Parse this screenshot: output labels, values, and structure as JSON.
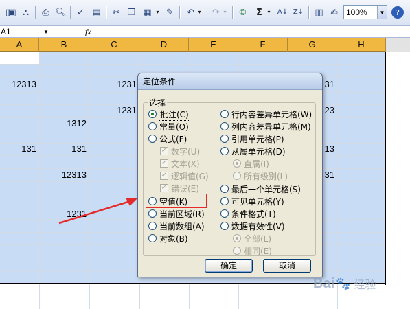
{
  "toolbar": {
    "icons": [
      "new-file-icon",
      "open-folder-icon",
      "save-icon",
      "permission-icon",
      "print-icon",
      "print-preview-icon",
      "spelling-icon",
      "research-icon",
      "cut-icon",
      "copy-icon",
      "paste-icon",
      "format-painter-icon",
      "undo-icon",
      "redo-icon",
      "hyperlink-icon",
      "autosum-icon",
      "sort-ascending-icon",
      "sort-descending-icon",
      "chart-wizard-icon",
      "drawing-icon"
    ],
    "autosum_glyph": "Σ",
    "zoom_value": "100%",
    "help_glyph": "?"
  },
  "formula_bar": {
    "name_box": "A1",
    "fx_label": "fx"
  },
  "columns": [
    "A",
    "B",
    "C",
    "D",
    "E",
    "F",
    "G",
    "H"
  ],
  "cells": {
    "a_r3": "12313",
    "c_r3": "1231",
    "c_r5": "1231",
    "b_r6": "1312",
    "a_r8": "131",
    "b_r8": "131",
    "b_r10": "12313",
    "b_r13": "1231",
    "g_r3": "31",
    "g_r5": "23",
    "g_r8": "13",
    "g_r10": "31"
  },
  "dialog": {
    "title": "定位条件",
    "group_label": "选择",
    "left_options": [
      {
        "label": "批注(C)",
        "checked": true
      },
      {
        "label": "常量(O)",
        "checked": false
      },
      {
        "label": "公式(F)",
        "checked": false
      },
      {
        "label": "数字(U)",
        "sub": true
      },
      {
        "label": "文本(X)",
        "sub": true
      },
      {
        "label": "逻辑值(G)",
        "sub": true
      },
      {
        "label": "错误(E)",
        "sub": true
      },
      {
        "label": "空值(K)",
        "checked": false
      },
      {
        "label": "当前区域(R)",
        "checked": false
      },
      {
        "label": "当前数组(A)",
        "checked": false
      },
      {
        "label": "对象(B)",
        "checked": false
      }
    ],
    "right_options": [
      {
        "label": "行内容差异单元格(W)"
      },
      {
        "label": "列内容差异单元格(M)"
      },
      {
        "label": "引用单元格(P)"
      },
      {
        "label": "从属单元格(D)"
      },
      {
        "label": "直属(I)",
        "sub": true,
        "checked": true
      },
      {
        "label": "所有级别(L)",
        "sub": true
      },
      {
        "label": "最后一个单元格(S)"
      },
      {
        "label": "可见单元格(Y)"
      },
      {
        "label": "条件格式(T)"
      },
      {
        "label": "数据有效性(V)"
      },
      {
        "label": "全部(L)",
        "sub": true,
        "checked": true
      },
      {
        "label": "相同(E)",
        "sub": true
      }
    ],
    "ok_label": "确定",
    "cancel_label": "取消"
  },
  "watermark": {
    "text_left": "Bai",
    "text_right": "经验",
    "paw_glyph": "🐾"
  },
  "colors": {
    "selection": "#c9dcf5",
    "header_selected": "#f0b840",
    "annotation_red": "#e32b2b"
  }
}
